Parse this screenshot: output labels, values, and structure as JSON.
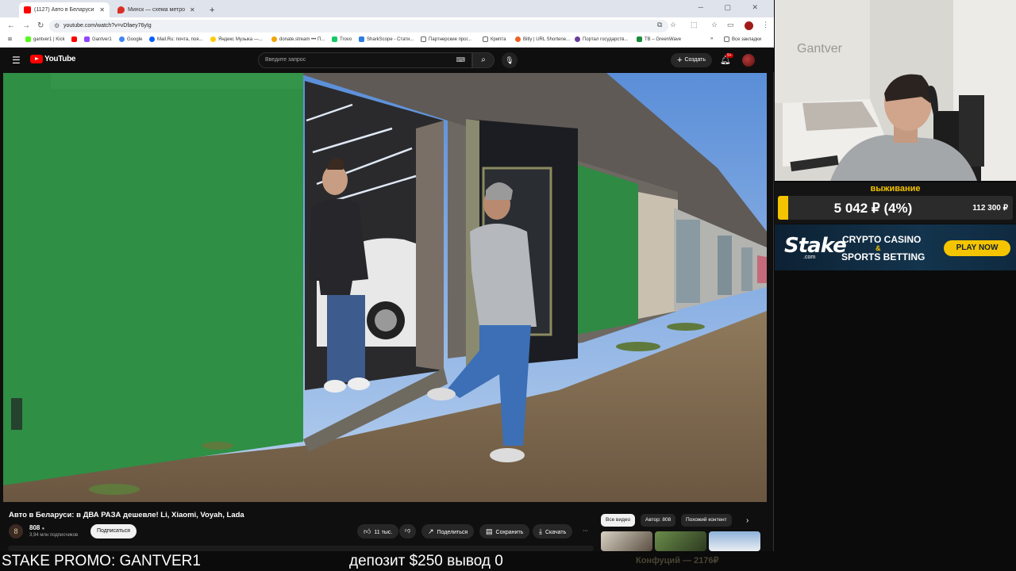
{
  "browser": {
    "tabs": [
      {
        "label": "(1127) Авто в Беларуси: в",
        "active": true,
        "favicon_color": "#ff0000"
      },
      {
        "label": "Минск — схема метро",
        "active": false,
        "favicon_color": "#d93025"
      }
    ],
    "new_tab": "+",
    "url": "youtube.com/watch?v=vDfaey76yIg",
    "bookmarks": [
      "gantver1 | Kick",
      "Gantver1",
      "Google",
      "Mail.Ru: почта, поя...",
      "Яндекс Музыка —...",
      "donate.stream ••• П...",
      "Trovo",
      "SharkScope - Стати...",
      "Партнерские прог...",
      "Крипта",
      "Bitly | URL Shortene...",
      "Портал государств...",
      "TB – GreenWave"
    ],
    "all_bookmarks": "Все закладки"
  },
  "youtube": {
    "logo_text": "YouTube",
    "search_placeholder": "Введите запрос",
    "create_label": "Создать",
    "notif_badge": "9+"
  },
  "video": {
    "title": "Авто в Беларуси: в ДВА РАЗА дешевле! Li, Xiaomi, Voyah, Lada",
    "channel": {
      "name": "808",
      "avatar_letter": "8",
      "subscribers": "3,94 млн подписчиков"
    },
    "subscribe_label": "Подписаться",
    "actions": {
      "likes": "11 тыс.",
      "share": "Поделиться",
      "save": "Сохранить",
      "download": "Скачать",
      "more": "···"
    }
  },
  "chips": [
    "Все видео",
    "Автор: 808",
    "Похожий контент"
  ],
  "stream_overlay": {
    "goal_title": "выживание",
    "goal_current": "5 042 ₽ (4%)",
    "goal_target": "112 300 ₽",
    "goal_progress": 0.04,
    "stake": {
      "logo": "Stake",
      "logo_sub": ".com",
      "line1": "CRYPTO CASINO",
      "amp": "&",
      "line2": "SPORTS BETTING",
      "cta": "PLAY NOW"
    },
    "cam_wall_text": "Gantver",
    "promo": "STAKE PROMO: GANTVER1",
    "deposit": "депозит $250 вывод 0",
    "ticker": "Конфуций — 2176₽"
  },
  "colors": {
    "yt_bg": "#0f0f0f",
    "yt_red": "#ff0000",
    "goal_yellow": "#f5c400",
    "stake_navy": "#0d2133"
  }
}
